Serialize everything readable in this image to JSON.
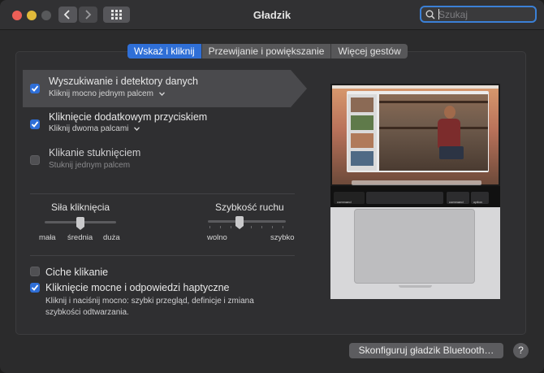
{
  "window": {
    "title": "Gładzik"
  },
  "search": {
    "placeholder": "Szukaj",
    "value": ""
  },
  "tabs": [
    {
      "label": "Wskaż i kliknij",
      "active": true
    },
    {
      "label": "Przewijanie i powiększanie",
      "active": false
    },
    {
      "label": "Więcej gestów",
      "active": false
    }
  ],
  "options": [
    {
      "title": "Wyszukiwanie i detektory danych",
      "subtitle": "Kliknij mocno jednym palcem",
      "checked": true,
      "has_menu": true
    },
    {
      "title": "Kliknięcie dodatkowym przyciskiem",
      "subtitle": "Kliknij dwoma palcami",
      "checked": true,
      "has_menu": true
    },
    {
      "title": "Klikanie stuknięciem",
      "subtitle": "Stuknij jednym palcem",
      "checked": false,
      "has_menu": false
    }
  ],
  "click_force": {
    "title": "Siła kliknięcia",
    "labels": [
      "mała",
      "średnia",
      "duża"
    ],
    "value": 0.5
  },
  "tracking_speed": {
    "title": "Szybkość ruchu",
    "left_label": "wolno",
    "right_label": "szybko",
    "value": 0.4
  },
  "bottom_options": [
    {
      "title": "Ciche klikanie",
      "checked": false
    },
    {
      "title": "Kliknięcie mocne i odpowiedzi haptyczne",
      "checked": true
    }
  ],
  "haptic_note": {
    "line1": "Kliknij i naciśnij mocno: szybki przegląd, definicje i zmiana",
    "line2": "szybkości odtwarzania."
  },
  "touchbar": {
    "key_left": "command",
    "key_right": "command",
    "key_opt": "option"
  },
  "buttons": {
    "bluetooth": "Skonfiguruj gładzik Bluetooth…",
    "help": "?"
  },
  "colors": {
    "accent": "#2f6fd7",
    "background": "#2b2b2c"
  }
}
